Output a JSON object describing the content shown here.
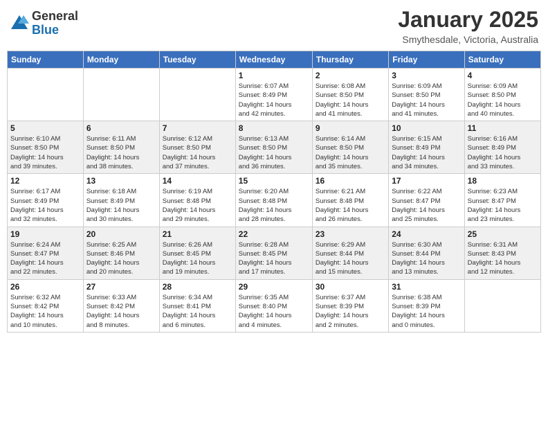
{
  "logo": {
    "general": "General",
    "blue": "Blue"
  },
  "title": "January 2025",
  "location": "Smythesdale, Victoria, Australia",
  "header_days": [
    "Sunday",
    "Monday",
    "Tuesday",
    "Wednesday",
    "Thursday",
    "Friday",
    "Saturday"
  ],
  "weeks": [
    [
      {
        "day": "",
        "info": ""
      },
      {
        "day": "",
        "info": ""
      },
      {
        "day": "",
        "info": ""
      },
      {
        "day": "1",
        "info": "Sunrise: 6:07 AM\nSunset: 8:49 PM\nDaylight: 14 hours\nand 42 minutes."
      },
      {
        "day": "2",
        "info": "Sunrise: 6:08 AM\nSunset: 8:50 PM\nDaylight: 14 hours\nand 41 minutes."
      },
      {
        "day": "3",
        "info": "Sunrise: 6:09 AM\nSunset: 8:50 PM\nDaylight: 14 hours\nand 41 minutes."
      },
      {
        "day": "4",
        "info": "Sunrise: 6:09 AM\nSunset: 8:50 PM\nDaylight: 14 hours\nand 40 minutes."
      }
    ],
    [
      {
        "day": "5",
        "info": "Sunrise: 6:10 AM\nSunset: 8:50 PM\nDaylight: 14 hours\nand 39 minutes."
      },
      {
        "day": "6",
        "info": "Sunrise: 6:11 AM\nSunset: 8:50 PM\nDaylight: 14 hours\nand 38 minutes."
      },
      {
        "day": "7",
        "info": "Sunrise: 6:12 AM\nSunset: 8:50 PM\nDaylight: 14 hours\nand 37 minutes."
      },
      {
        "day": "8",
        "info": "Sunrise: 6:13 AM\nSunset: 8:50 PM\nDaylight: 14 hours\nand 36 minutes."
      },
      {
        "day": "9",
        "info": "Sunrise: 6:14 AM\nSunset: 8:50 PM\nDaylight: 14 hours\nand 35 minutes."
      },
      {
        "day": "10",
        "info": "Sunrise: 6:15 AM\nSunset: 8:49 PM\nDaylight: 14 hours\nand 34 minutes."
      },
      {
        "day": "11",
        "info": "Sunrise: 6:16 AM\nSunset: 8:49 PM\nDaylight: 14 hours\nand 33 minutes."
      }
    ],
    [
      {
        "day": "12",
        "info": "Sunrise: 6:17 AM\nSunset: 8:49 PM\nDaylight: 14 hours\nand 32 minutes."
      },
      {
        "day": "13",
        "info": "Sunrise: 6:18 AM\nSunset: 8:49 PM\nDaylight: 14 hours\nand 30 minutes."
      },
      {
        "day": "14",
        "info": "Sunrise: 6:19 AM\nSunset: 8:48 PM\nDaylight: 14 hours\nand 29 minutes."
      },
      {
        "day": "15",
        "info": "Sunrise: 6:20 AM\nSunset: 8:48 PM\nDaylight: 14 hours\nand 28 minutes."
      },
      {
        "day": "16",
        "info": "Sunrise: 6:21 AM\nSunset: 8:48 PM\nDaylight: 14 hours\nand 26 minutes."
      },
      {
        "day": "17",
        "info": "Sunrise: 6:22 AM\nSunset: 8:47 PM\nDaylight: 14 hours\nand 25 minutes."
      },
      {
        "day": "18",
        "info": "Sunrise: 6:23 AM\nSunset: 8:47 PM\nDaylight: 14 hours\nand 23 minutes."
      }
    ],
    [
      {
        "day": "19",
        "info": "Sunrise: 6:24 AM\nSunset: 8:47 PM\nDaylight: 14 hours\nand 22 minutes."
      },
      {
        "day": "20",
        "info": "Sunrise: 6:25 AM\nSunset: 8:46 PM\nDaylight: 14 hours\nand 20 minutes."
      },
      {
        "day": "21",
        "info": "Sunrise: 6:26 AM\nSunset: 8:45 PM\nDaylight: 14 hours\nand 19 minutes."
      },
      {
        "day": "22",
        "info": "Sunrise: 6:28 AM\nSunset: 8:45 PM\nDaylight: 14 hours\nand 17 minutes."
      },
      {
        "day": "23",
        "info": "Sunrise: 6:29 AM\nSunset: 8:44 PM\nDaylight: 14 hours\nand 15 minutes."
      },
      {
        "day": "24",
        "info": "Sunrise: 6:30 AM\nSunset: 8:44 PM\nDaylight: 14 hours\nand 13 minutes."
      },
      {
        "day": "25",
        "info": "Sunrise: 6:31 AM\nSunset: 8:43 PM\nDaylight: 14 hours\nand 12 minutes."
      }
    ],
    [
      {
        "day": "26",
        "info": "Sunrise: 6:32 AM\nSunset: 8:42 PM\nDaylight: 14 hours\nand 10 minutes."
      },
      {
        "day": "27",
        "info": "Sunrise: 6:33 AM\nSunset: 8:42 PM\nDaylight: 14 hours\nand 8 minutes."
      },
      {
        "day": "28",
        "info": "Sunrise: 6:34 AM\nSunset: 8:41 PM\nDaylight: 14 hours\nand 6 minutes."
      },
      {
        "day": "29",
        "info": "Sunrise: 6:35 AM\nSunset: 8:40 PM\nDaylight: 14 hours\nand 4 minutes."
      },
      {
        "day": "30",
        "info": "Sunrise: 6:37 AM\nSunset: 8:39 PM\nDaylight: 14 hours\nand 2 minutes."
      },
      {
        "day": "31",
        "info": "Sunrise: 6:38 AM\nSunset: 8:39 PM\nDaylight: 14 hours\nand 0 minutes."
      },
      {
        "day": "",
        "info": ""
      }
    ]
  ]
}
